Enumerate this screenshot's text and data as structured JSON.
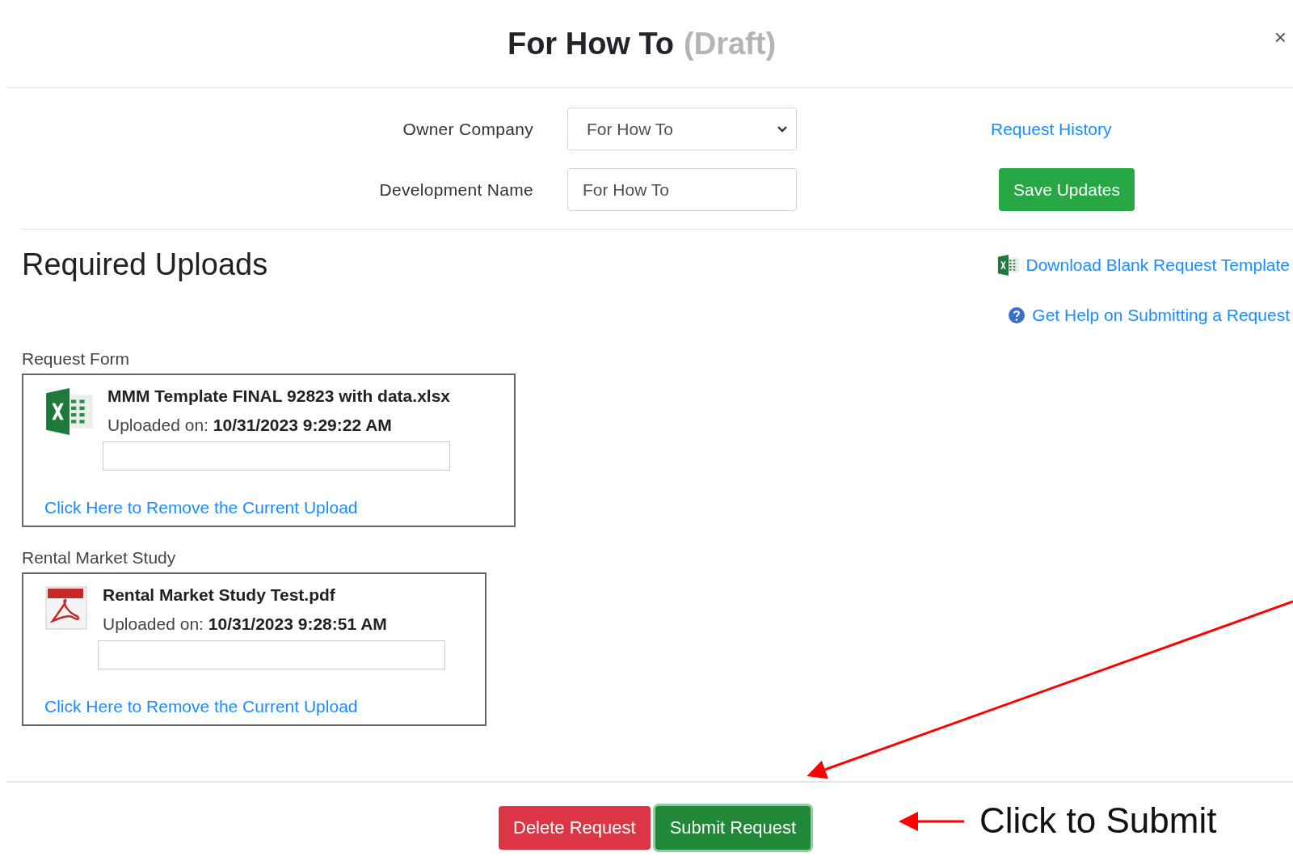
{
  "dialog": {
    "title": "For How To",
    "status": "(Draft)",
    "close": "×"
  },
  "form": {
    "fields": [
      {
        "kind": "select",
        "label": "Owner Company",
        "value": "For How To"
      },
      {
        "kind": "text",
        "label": "Development Name",
        "value": "For How To"
      }
    ],
    "link": "Request History",
    "save_button": "Save Updates"
  },
  "uploads": {
    "heading": "Required Uploads",
    "links": [
      {
        "kind": "excel",
        "text": "Download Blank Request Template"
      },
      {
        "kind": "help",
        "text": "Get Help on Submitting a Request"
      }
    ],
    "items": [
      {
        "label": "Request Form",
        "kind": "excel",
        "file": "MMM Template FINAL 92823 with data.xlsx",
        "uploaded_label": "Uploaded on:",
        "uploaded": "10/31/2023 9:29:22 AM",
        "remove": "Click Here to Remove the Current Upload"
      },
      {
        "label": "Rental Market Study",
        "kind": "pdf",
        "file": "Rental Market Study Test.pdf",
        "uploaded_label": "Uploaded on:",
        "uploaded": "10/31/2023 9:28:51 AM",
        "remove": "Click Here to Remove the Current Upload"
      }
    ]
  },
  "footer": {
    "delete_button": "Delete Request",
    "submit_button": "Submit Request"
  },
  "annotation": {
    "text": "Click to Submit"
  }
}
